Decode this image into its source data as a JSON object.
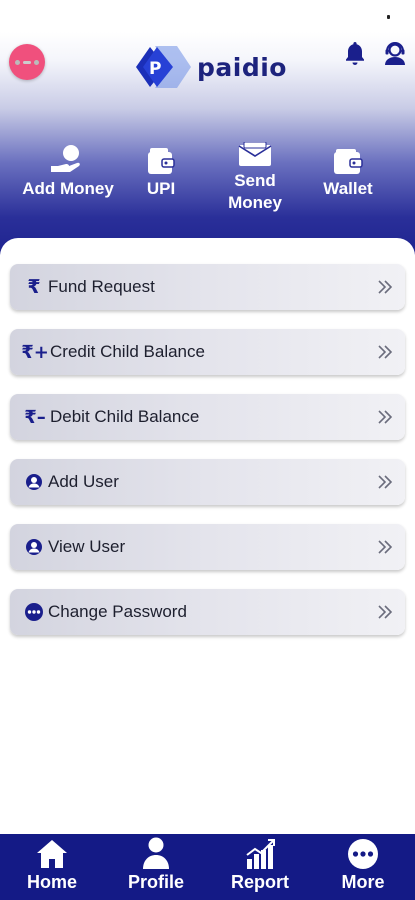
{
  "app": {
    "brand": "paidio"
  },
  "header": {
    "menu_toggle_icon": "menu-dots-icon",
    "notification_icon": "bell-icon",
    "support_icon": "support-agent-icon"
  },
  "quick_actions": [
    {
      "label": "Add Money",
      "icon": "hand-coin-icon"
    },
    {
      "label": "UPI",
      "icon": "wallet-icon"
    },
    {
      "label": "Send\nMoney",
      "label_line1": "Send",
      "label_line2": "Money",
      "icon": "money-envelope-icon"
    },
    {
      "label": "Wallet",
      "icon": "wallet-icon"
    }
  ],
  "menu": {
    "items": [
      {
        "label": "Fund Request",
        "icon": "rupee-icon",
        "icon_text": "₹"
      },
      {
        "label": "Credit Child Balance",
        "icon": "rupee-plus-icon",
        "icon_text": "₹+"
      },
      {
        "label": "Debit Child Balance",
        "icon": "rupee-minus-icon",
        "icon_text": "₹–"
      },
      {
        "label": "Add User",
        "icon": "user-circle-icon"
      },
      {
        "label": "View User",
        "icon": "user-circle-icon"
      },
      {
        "label": "Change Password",
        "icon": "more-circle-icon"
      }
    ]
  },
  "bottom_nav": {
    "items": [
      {
        "label": "Home",
        "icon": "home-icon"
      },
      {
        "label": "Profile",
        "icon": "person-icon"
      },
      {
        "label": "Report",
        "icon": "bar-chart-icon"
      },
      {
        "label": "More",
        "icon": "more-circle-icon"
      }
    ]
  },
  "colors": {
    "brand_navy": "#1a1f8c",
    "menu_toggle_pink": "#f0507d",
    "bottom_nav": "#141a86"
  }
}
